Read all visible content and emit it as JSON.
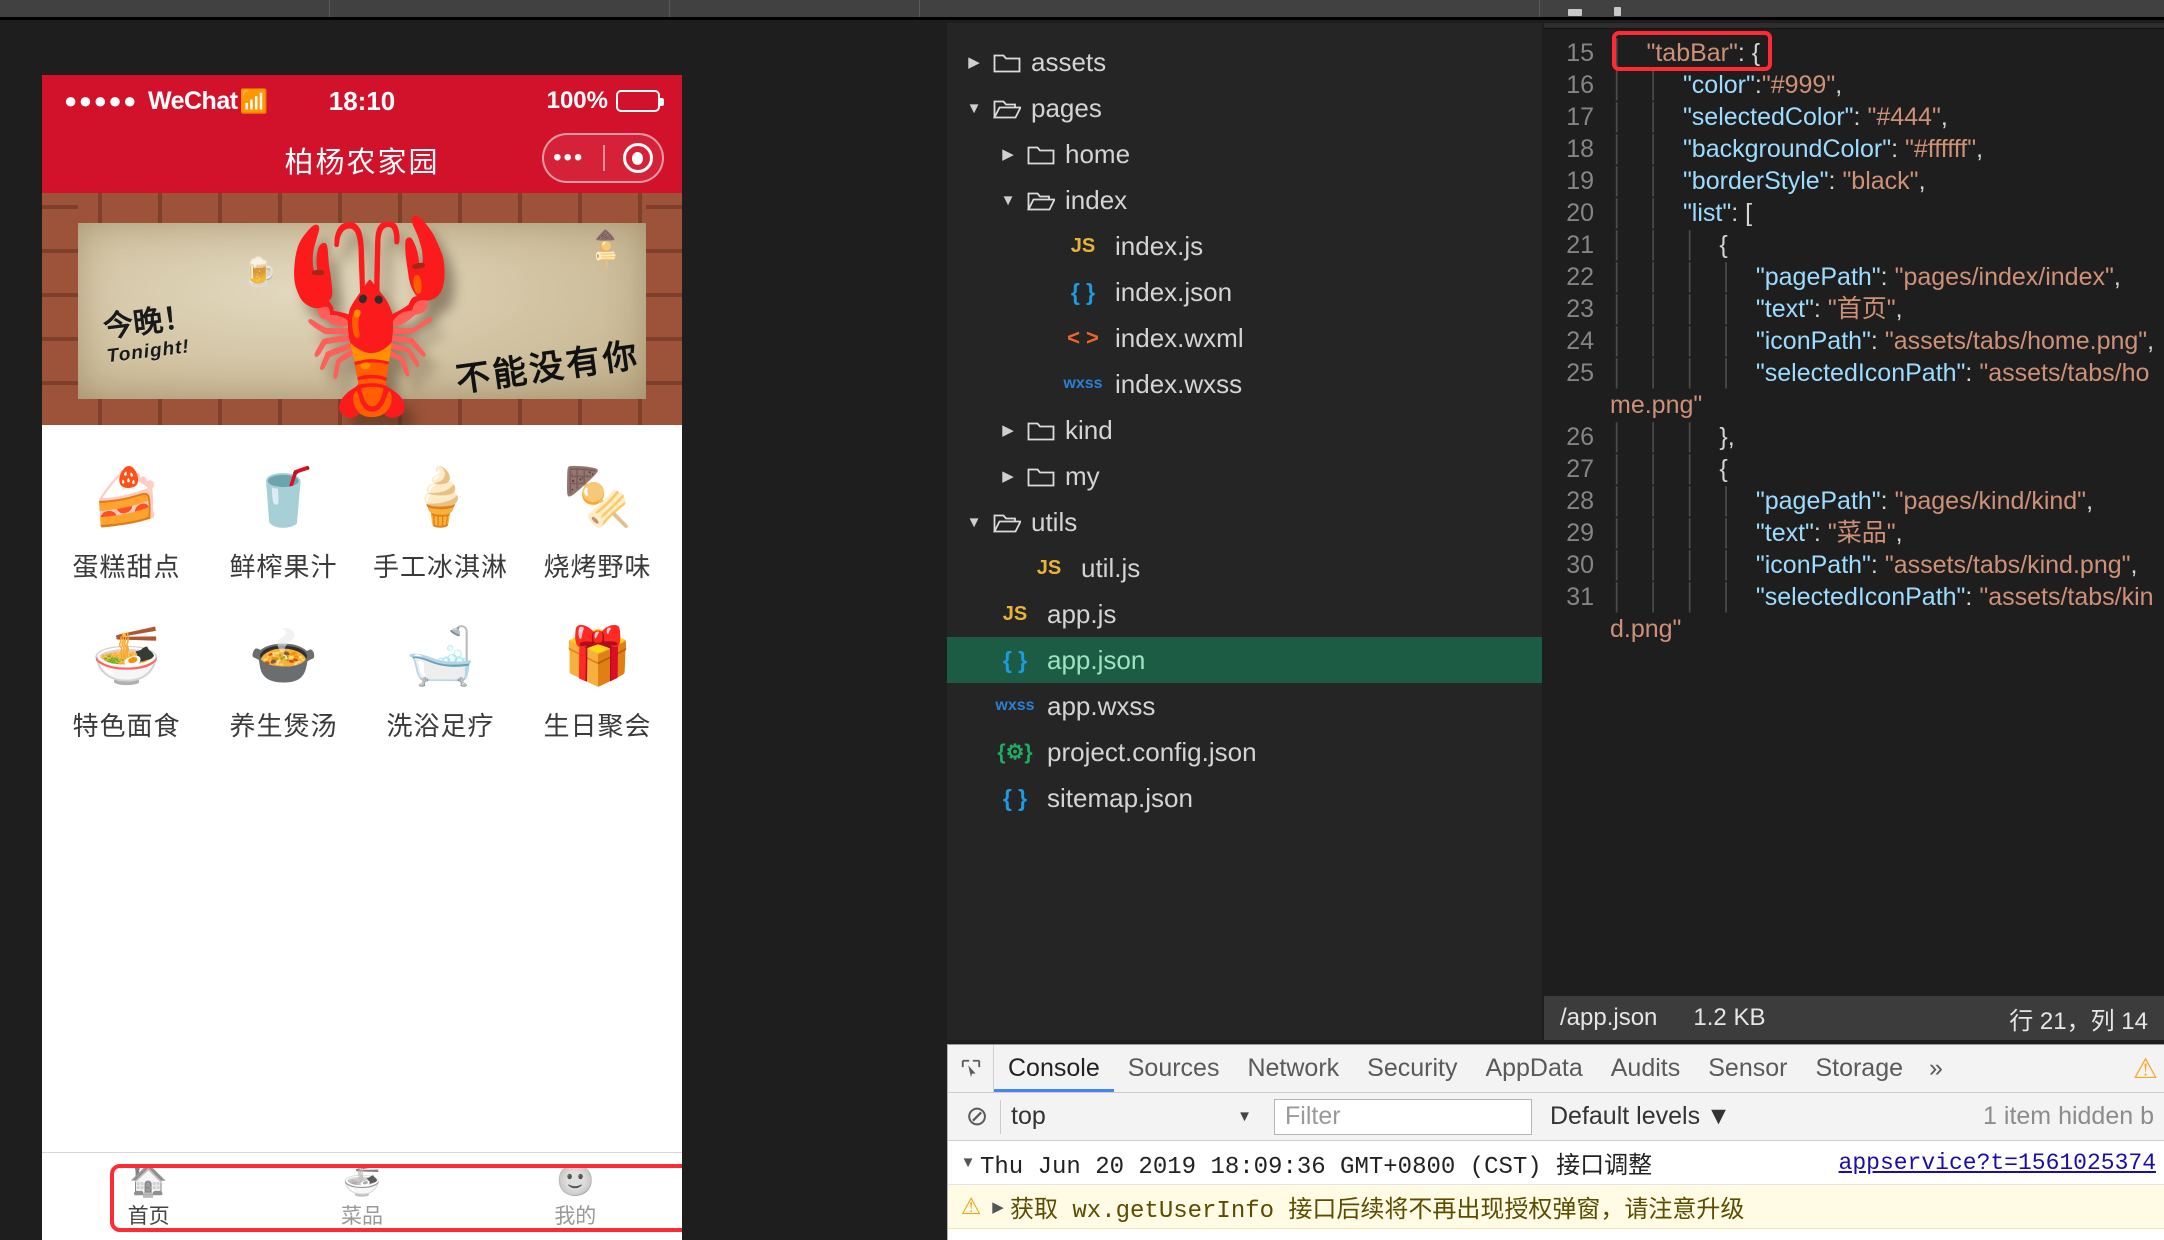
{
  "simulator": {
    "status_bar": {
      "signal_dots": "●●●●●",
      "carrier": "WeChat",
      "wifi_icon": "wifi-icon",
      "time": "18:10",
      "battery_pct": "100%"
    },
    "nav_bar": {
      "title": "柏杨农家园",
      "more_icon": "more-dots-icon",
      "target_icon": "capsule-target-icon"
    },
    "banner": {
      "alt": "crawfish-promo-banner",
      "text_cn": "今晚！",
      "text_en": "Tonight!",
      "text_right": "不能没有你",
      "lobster_icon": "lobster-icon",
      "doodle_icon": "beer-mug-doodle-icon",
      "skewer_icon": "skewer-doodle-icon"
    },
    "grid": [
      {
        "icon": "cake-icon",
        "glyph": "🍰",
        "label": "蛋糕甜点"
      },
      {
        "icon": "juice-icon",
        "glyph": "🥤",
        "label": "鲜榨果汁"
      },
      {
        "icon": "icecream-icon",
        "glyph": "🍦",
        "label": "手工冰淇淋"
      },
      {
        "icon": "skewer-icon",
        "glyph": "🍢",
        "label": "烧烤野味"
      },
      {
        "icon": "noodles-icon",
        "glyph": "🍜",
        "label": "特色面食"
      },
      {
        "icon": "pot-icon",
        "glyph": "🍲",
        "label": "养生煲汤"
      },
      {
        "icon": "bathtub-icon",
        "glyph": "🛁",
        "label": "洗浴足疗"
      },
      {
        "icon": "gift-icon",
        "glyph": "🎁",
        "label": "生日聚会"
      }
    ],
    "tabbar": [
      {
        "icon": "home-tab-icon",
        "glyph": "🏠",
        "label": "首页",
        "selected": true
      },
      {
        "icon": "kind-tab-icon",
        "glyph": "🍜",
        "label": "菜品",
        "selected": false
      },
      {
        "icon": "my-tab-icon",
        "glyph": "🙂",
        "label": "我的",
        "selected": false
      }
    ]
  },
  "filetree": [
    {
      "depth": 0,
      "type": "folder",
      "state": "collapsed",
      "name": "assets"
    },
    {
      "depth": 0,
      "type": "folder",
      "state": "expanded",
      "name": "pages"
    },
    {
      "depth": 1,
      "type": "folder",
      "state": "collapsed",
      "name": "home"
    },
    {
      "depth": 1,
      "type": "folder",
      "state": "expanded",
      "name": "index"
    },
    {
      "depth": 2,
      "type": "js",
      "name": "index.js",
      "badge": "JS"
    },
    {
      "depth": 2,
      "type": "json",
      "name": "index.json",
      "badge": "{ }"
    },
    {
      "depth": 2,
      "type": "wxml",
      "name": "index.wxml",
      "badge": "< >"
    },
    {
      "depth": 2,
      "type": "wxss",
      "name": "index.wxss",
      "badge": "wxss"
    },
    {
      "depth": 1,
      "type": "folder",
      "state": "collapsed",
      "name": "kind"
    },
    {
      "depth": 1,
      "type": "folder",
      "state": "collapsed",
      "name": "my"
    },
    {
      "depth": 0,
      "type": "folder",
      "state": "expanded",
      "name": "utils"
    },
    {
      "depth": 1,
      "type": "js",
      "name": "util.js",
      "badge": "JS"
    },
    {
      "depth": 0,
      "type": "js",
      "name": "app.js",
      "badge": "JS"
    },
    {
      "depth": 0,
      "type": "json",
      "name": "app.json",
      "badge": "{ }",
      "selected": true
    },
    {
      "depth": 0,
      "type": "wxss",
      "name": "app.wxss",
      "badge": "wxss"
    },
    {
      "depth": 0,
      "type": "cfg",
      "name": "project.config.json",
      "badge": "{⚙}"
    },
    {
      "depth": 0,
      "type": "json",
      "name": "sitemap.json",
      "badge": "{ }"
    }
  ],
  "editor": {
    "annotation_target": "tabBar-key-highlight",
    "lines": [
      {
        "no": "15",
        "indent": 1,
        "segments": [
          {
            "t": "str",
            "v": "\"tabBar\""
          },
          {
            "t": "pun",
            "v": ": {"
          }
        ]
      },
      {
        "no": "16",
        "indent": 2,
        "segments": [
          {
            "t": "key",
            "v": "\"color\""
          },
          {
            "t": "pun",
            "v": ":"
          },
          {
            "t": "str",
            "v": "\"#999\""
          },
          {
            "t": "pun",
            "v": ","
          }
        ]
      },
      {
        "no": "17",
        "indent": 2,
        "segments": [
          {
            "t": "key",
            "v": "\"selectedColor\""
          },
          {
            "t": "pun",
            "v": ": "
          },
          {
            "t": "str",
            "v": "\"#444\""
          },
          {
            "t": "pun",
            "v": ","
          }
        ]
      },
      {
        "no": "18",
        "indent": 2,
        "segments": [
          {
            "t": "key",
            "v": "\"backgroundColor\""
          },
          {
            "t": "pun",
            "v": ": "
          },
          {
            "t": "str",
            "v": "\"#ffffff\""
          },
          {
            "t": "pun",
            "v": ","
          }
        ]
      },
      {
        "no": "19",
        "indent": 2,
        "segments": [
          {
            "t": "key",
            "v": "\"borderStyle\""
          },
          {
            "t": "pun",
            "v": ": "
          },
          {
            "t": "str",
            "v": "\"black\""
          },
          {
            "t": "pun",
            "v": ","
          }
        ]
      },
      {
        "no": "20",
        "indent": 2,
        "segments": [
          {
            "t": "key",
            "v": "\"list\""
          },
          {
            "t": "pun",
            "v": ": ["
          }
        ]
      },
      {
        "no": "21",
        "indent": 3,
        "segments": [
          {
            "t": "pun",
            "v": "{"
          }
        ]
      },
      {
        "no": "22",
        "indent": 4,
        "segments": [
          {
            "t": "key",
            "v": "\"pagePath\""
          },
          {
            "t": "pun",
            "v": ": "
          },
          {
            "t": "str",
            "v": "\"pages/index/index\""
          },
          {
            "t": "pun",
            "v": ","
          }
        ]
      },
      {
        "no": "23",
        "indent": 4,
        "segments": [
          {
            "t": "key",
            "v": "\"text\""
          },
          {
            "t": "pun",
            "v": ": "
          },
          {
            "t": "str",
            "v": "\"首页\""
          },
          {
            "t": "pun",
            "v": ","
          }
        ]
      },
      {
        "no": "24",
        "indent": 4,
        "segments": [
          {
            "t": "key",
            "v": "\"iconPath\""
          },
          {
            "t": "pun",
            "v": ": "
          },
          {
            "t": "str",
            "v": "\"assets/tabs/home.png\""
          },
          {
            "t": "pun",
            "v": ","
          }
        ]
      },
      {
        "no": "25",
        "indent": 4,
        "segments": [
          {
            "t": "key",
            "v": "\"selectedIconPath\""
          },
          {
            "t": "pun",
            "v": ": "
          },
          {
            "t": "str",
            "v": "\"assets/tabs/home.png\""
          }
        ]
      },
      {
        "no": "26",
        "indent": 3,
        "segments": [
          {
            "t": "pun",
            "v": "},"
          }
        ]
      },
      {
        "no": "27",
        "indent": 3,
        "segments": [
          {
            "t": "pun",
            "v": "{"
          }
        ]
      },
      {
        "no": "28",
        "indent": 4,
        "segments": [
          {
            "t": "key",
            "v": "\"pagePath\""
          },
          {
            "t": "pun",
            "v": ": "
          },
          {
            "t": "str",
            "v": "\"pages/kind/kind\""
          },
          {
            "t": "pun",
            "v": ","
          }
        ]
      },
      {
        "no": "29",
        "indent": 4,
        "segments": [
          {
            "t": "key",
            "v": "\"text\""
          },
          {
            "t": "pun",
            "v": ": "
          },
          {
            "t": "str",
            "v": "\"菜品\""
          },
          {
            "t": "pun",
            "v": ","
          }
        ]
      },
      {
        "no": "30",
        "indent": 4,
        "segments": [
          {
            "t": "key",
            "v": "\"iconPath\""
          },
          {
            "t": "pun",
            "v": ": "
          },
          {
            "t": "str",
            "v": "\"assets/tabs/kind.png\""
          },
          {
            "t": "pun",
            "v": ","
          }
        ]
      },
      {
        "no": "31",
        "indent": 4,
        "segments": [
          {
            "t": "key",
            "v": "\"selectedIconPath\""
          },
          {
            "t": "pun",
            "v": ": "
          },
          {
            "t": "str",
            "v": "\"assets/tabs/kind.png\""
          }
        ]
      }
    ],
    "statusbar": {
      "path": "/app.json",
      "size": "1.2 KB",
      "position": "行 21，列 14"
    }
  },
  "devtools": {
    "inspect_icon": "inspect-element-icon",
    "tabs": [
      {
        "label": "Console",
        "active": true
      },
      {
        "label": "Sources",
        "active": false
      },
      {
        "label": "Network",
        "active": false
      },
      {
        "label": "Security",
        "active": false
      },
      {
        "label": "AppData",
        "active": false
      },
      {
        "label": "Audits",
        "active": false
      },
      {
        "label": "Sensor",
        "active": false
      },
      {
        "label": "Storage",
        "active": false
      }
    ],
    "more_tabs_icon": "»",
    "warning_badge_icon": "warning-triangle-icon",
    "toolbar": {
      "clear_icon": "clear-console-icon",
      "context": "top",
      "context_caret": "▼",
      "filter_placeholder": "Filter",
      "levels": "Default levels",
      "levels_caret": "▼",
      "hidden_count": "1 item hidden b"
    },
    "messages": [
      {
        "kind": "log",
        "twisty": "▼",
        "text": "Thu Jun 20 2019 18:09:36 GMT+0800 (CST) 接口调整",
        "link": "appservice?t=1561025374"
      },
      {
        "kind": "warn",
        "icon": "warning-triangle-icon",
        "twisty": "▶",
        "text": "获取 wx.getUserInfo 接口后续将不再出现授权弹窗，请注意升级",
        "link": ""
      }
    ]
  }
}
